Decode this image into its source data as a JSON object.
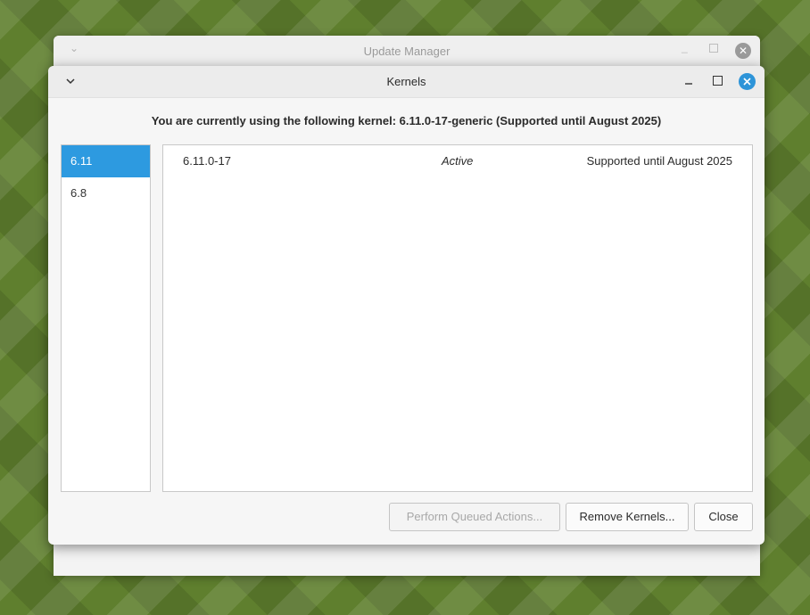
{
  "background_window": {
    "title": "Update Manager"
  },
  "dialog": {
    "title": "Kernels",
    "info_text": "You are currently using the following kernel: 6.11.0-17-generic (Supported until August 2025)"
  },
  "sidebar": {
    "items": [
      {
        "label": "6.11",
        "selected": true
      },
      {
        "label": "6.8",
        "selected": false
      }
    ]
  },
  "kernels": [
    {
      "version": "6.11.0-17",
      "status": "Active",
      "support": "Supported until August 2025"
    }
  ],
  "buttons": {
    "perform_queued": "Perform Queued Actions...",
    "remove_kernels": "Remove Kernels...",
    "close": "Close"
  },
  "colors": {
    "accent": "#2d9ae0",
    "close_button": "#2d94d8",
    "desktop": "#5f7f2e"
  }
}
